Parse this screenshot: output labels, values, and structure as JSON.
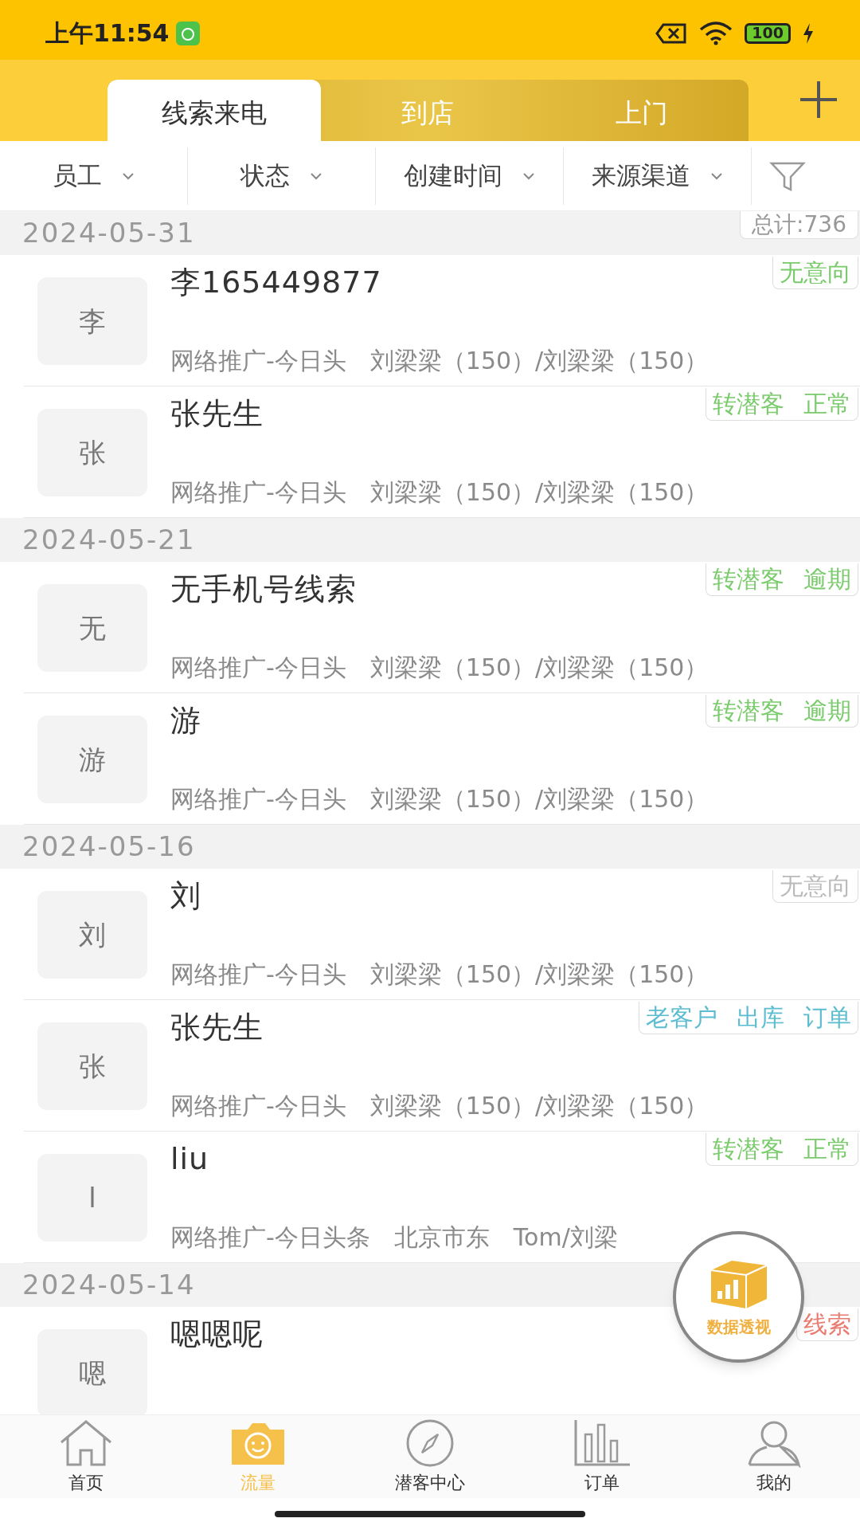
{
  "status_bar": {
    "time": "上午11:54",
    "battery": "100"
  },
  "tabs": [
    {
      "label": "线索来电",
      "selected": true
    },
    {
      "label": "到店",
      "selected": false
    },
    {
      "label": "上门",
      "selected": false
    }
  ],
  "filters": [
    "员工",
    "状态",
    "创建时间",
    "来源渠道"
  ],
  "total": "总计:736",
  "sections": [
    {
      "date": "2024-05-31",
      "rows": [
        {
          "avatar": "李",
          "name": "李165449877",
          "source": "网络推广-今日头",
          "staff": "刘梁梁（150）/刘梁梁（150）",
          "tags": [
            {
              "label": "无意向",
              "color": "#7acb6c"
            }
          ]
        },
        {
          "avatar": "张",
          "name": "张先生",
          "source": "网络推广-今日头",
          "staff": "刘梁梁（150）/刘梁梁（150）",
          "tags": [
            {
              "label": "转潜客",
              "color": "#7acb6c"
            },
            {
              "label": "正常",
              "color": "#7acb6c"
            }
          ]
        }
      ]
    },
    {
      "date": "2024-05-21",
      "rows": [
        {
          "avatar": "无",
          "name": "无手机号线索",
          "source": "网络推广-今日头",
          "staff": "刘梁梁（150）/刘梁梁（150）",
          "tags": [
            {
              "label": "转潜客",
              "color": "#7acb6c"
            },
            {
              "label": "逾期",
              "color": "#7acb6c"
            }
          ]
        },
        {
          "avatar": "游",
          "name": "游",
          "source": "网络推广-今日头",
          "staff": "刘梁梁（150）/刘梁梁（150）",
          "tags": [
            {
              "label": "转潜客",
              "color": "#7acb6c"
            },
            {
              "label": "逾期",
              "color": "#7acb6c"
            }
          ]
        }
      ]
    },
    {
      "date": "2024-05-16",
      "rows": [
        {
          "avatar": "刘",
          "name": "刘",
          "source": "网络推广-今日头",
          "staff": "刘梁梁（150）/刘梁梁（150）",
          "tags": [
            {
              "label": "无意向",
              "color": "#bbbbbb"
            }
          ]
        },
        {
          "avatar": "张",
          "name": "张先生",
          "source": "网络推广-今日头",
          "staff": "刘梁梁（150）/刘梁梁（150）",
          "tags": [
            {
              "label": "老客户",
              "color": "#5dbdd0"
            },
            {
              "label": "出库",
              "color": "#5dbdd0"
            },
            {
              "label": "订单",
              "color": "#5dbdd0"
            }
          ]
        },
        {
          "avatar": "l",
          "name": "liu",
          "source": "网络推广-今日头条",
          "address": "北京市东",
          "staff": "Tom/刘梁",
          "tags": [
            {
              "label": "转潜客",
              "color": "#7acb6c"
            },
            {
              "label": "正常",
              "color": "#7acb6c"
            }
          ]
        }
      ]
    },
    {
      "date": "2024-05-14",
      "rows": [
        {
          "avatar": "嗯",
          "name": "嗯嗯呢",
          "tags": [
            {
              "label": "线索",
              "color": "#ea7b70"
            }
          ]
        }
      ]
    }
  ],
  "float_button": {
    "label": "数据透视"
  },
  "nav": [
    {
      "label": "首页",
      "kind": "home",
      "selected": false
    },
    {
      "label": "流量",
      "kind": "traffic",
      "selected": true
    },
    {
      "label": "潜客中心",
      "kind": "compass",
      "selected": false
    },
    {
      "label": "订单",
      "kind": "chart",
      "selected": false
    },
    {
      "label": "我的",
      "kind": "user",
      "selected": false
    }
  ]
}
